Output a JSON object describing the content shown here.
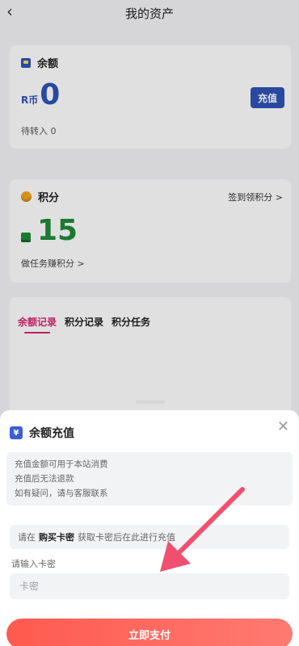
{
  "header": {
    "back_icon": "chevron-left-icon",
    "title": "我的资产"
  },
  "balance_card": {
    "title": "余额",
    "unit": "R币",
    "amount": "0",
    "pending": "待转入 0",
    "recharge_label": "充值"
  },
  "points_card": {
    "title": "积分",
    "signin_link": "签到领积分 >",
    "points": "15",
    "task_link": "做任务赚积分 >"
  },
  "tabs": [
    {
      "label": "余额记录",
      "active": true
    },
    {
      "label": "积分记录",
      "active": false
    },
    {
      "label": "积分任务",
      "active": false
    }
  ],
  "sheet": {
    "title": "余额充值",
    "yen_icon": "¥",
    "notice_lines": [
      "充值金额可用于本站消费",
      "充值后无法退款",
      "如有疑问，请与客服联系"
    ],
    "hint_prefix": "请在",
    "hint_bold": "购买卡密",
    "hint_suffix": "获取卡密后在此进行充值",
    "input_label": "请输入卡密",
    "input_placeholder": "卡密",
    "input_value": "",
    "pay_label": "立即支付"
  },
  "colors": {
    "accent": "#2f54b8",
    "points": "#1f8a3a",
    "tab_active": "#d8266e",
    "pay": "#ff5a4e",
    "arrow": "#f0506e"
  }
}
